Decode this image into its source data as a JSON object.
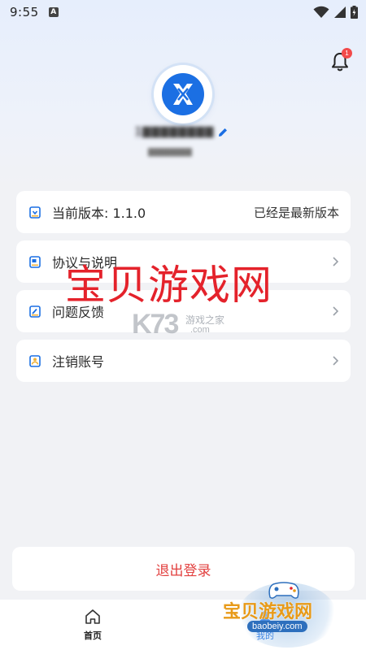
{
  "status_bar": {
    "time": "9:55",
    "app_icon_letter": "A",
    "icons": [
      "wifi-icon",
      "signal-icon",
      "battery-icon"
    ]
  },
  "header": {
    "notification_count": "1",
    "username": "1▇▇▇▇▇▇▇▇",
    "subtitle": "▇▇▇▇▇▇▇"
  },
  "menu": [
    {
      "label": "当前版本: 1.1.0",
      "right_text": "已经是最新版本",
      "icon": "version-icon"
    },
    {
      "label": "协议与说明",
      "icon": "agreement-icon"
    },
    {
      "label": "问题反馈",
      "icon": "feedback-icon"
    },
    {
      "label": "注销账号",
      "icon": "deactivate-icon"
    }
  ],
  "logout": {
    "label": "退出登录"
  },
  "bottom_nav": {
    "home_label": "首页",
    "mine_label": "我的"
  },
  "watermarks": {
    "center": "宝贝游戏网",
    "k73": "K73",
    "k73_cn": "游戏之家",
    "k73_domain": ".com",
    "badge_title": "宝贝游戏网",
    "badge_url": "baobeiy.com"
  },
  "colors": {
    "accent": "#1b6fe3",
    "danger": "#e2403f",
    "badge": "#f24a4a",
    "watermark_red": "#e4222b"
  }
}
